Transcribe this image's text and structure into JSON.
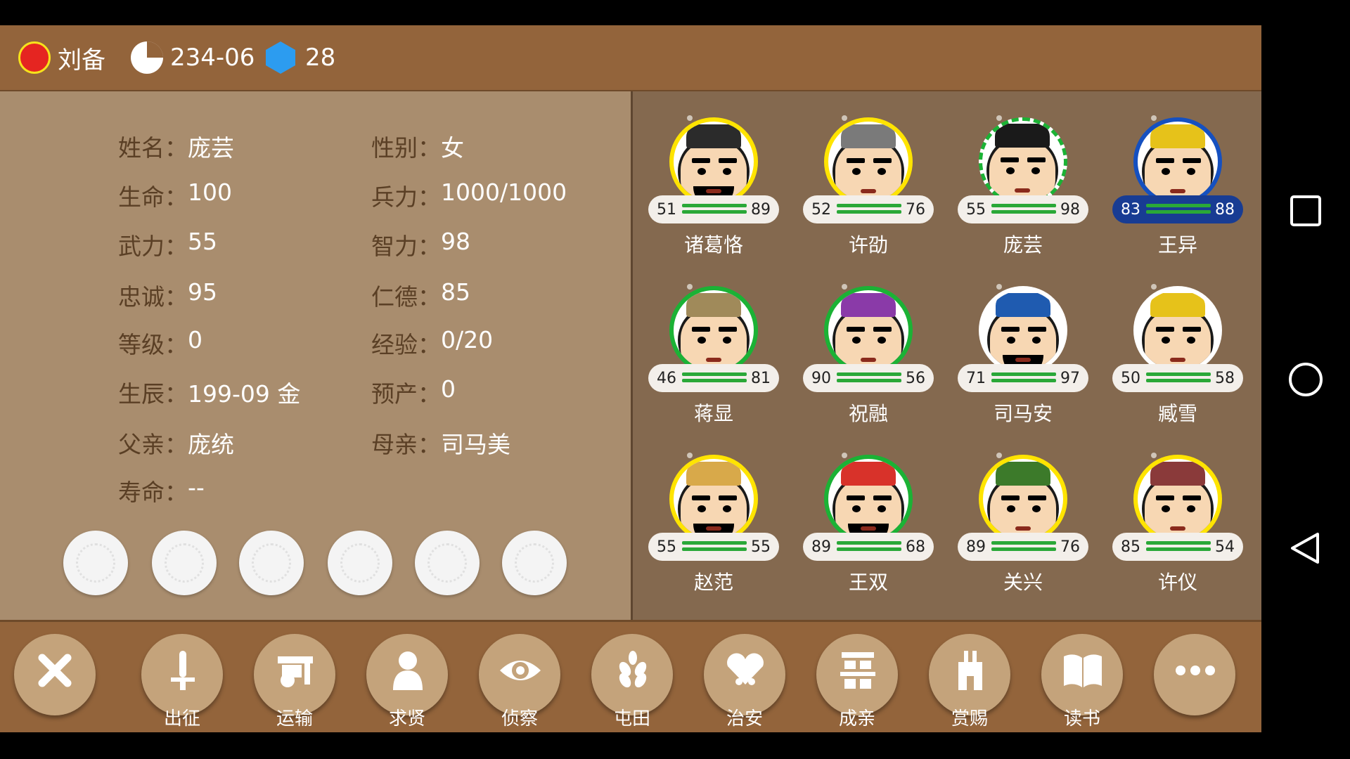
{
  "header": {
    "lord_name": "刘备",
    "date": "234-06",
    "gems": "28",
    "colors": {
      "faction": "#e52521",
      "faction_ring": "#f7e21b",
      "gem": "#2c9cf0"
    }
  },
  "info": {
    "rows": [
      {
        "k1": "姓名：",
        "v1": "庞芸",
        "k2": "性别：",
        "v2": "女"
      },
      {
        "k1": "生命：",
        "v1": "100",
        "k2": "兵力：",
        "v2": "1000/1000"
      },
      {
        "k1": "武力：",
        "v1": "55",
        "k2": "智力：",
        "v2": "98"
      },
      {
        "k1": "忠诚：",
        "v1": "95",
        "k2": "仁德：",
        "v2": "85"
      },
      {
        "k1": "等级：",
        "v1": "0",
        "k2": "经验：",
        "v2": "0/20"
      },
      {
        "k1": "生辰：",
        "v1": "199-09 金",
        "k2": "预产：",
        "v2": "0"
      },
      {
        "k1": "父亲：",
        "v1": "庞统",
        "k2": "母亲：",
        "v2": "司马美"
      },
      {
        "k1": "寿命：",
        "v1": "--",
        "k2": "",
        "v2": ""
      }
    ],
    "item_slots": 6
  },
  "generals": [
    {
      "name": "诸葛恪",
      "left": "51",
      "right": "89",
      "ring": "yellow",
      "hat": "#2b2b2b",
      "beard": true
    },
    {
      "name": "许劭",
      "left": "52",
      "right": "76",
      "ring": "yellow",
      "hat": "#7a7a7a",
      "beard": false
    },
    {
      "name": "庞芸",
      "left": "55",
      "right": "98",
      "ring": "green-dash",
      "hat": "#1a1a1a",
      "beard": false
    },
    {
      "name": "王异",
      "left": "83",
      "right": "88",
      "ring": "blue",
      "hat": "#e6c21a",
      "beard": false,
      "selected": true
    },
    {
      "name": "蒋显",
      "left": "46",
      "right": "81",
      "ring": "green",
      "hat": "#a08a5a",
      "beard": false
    },
    {
      "name": "祝融",
      "left": "90",
      "right": "56",
      "ring": "green",
      "hat": "#8a3aa8",
      "beard": false
    },
    {
      "name": "司马安",
      "left": "71",
      "right": "97",
      "ring": "white",
      "hat": "#1f5bb0",
      "beard": true
    },
    {
      "name": "臧雪",
      "left": "50",
      "right": "58",
      "ring": "white",
      "hat": "#e6c21a",
      "beard": false
    },
    {
      "name": "赵范",
      "left": "55",
      "right": "55",
      "ring": "yellow",
      "hat": "#d8a94a",
      "beard": true
    },
    {
      "name": "王双",
      "left": "89",
      "right": "68",
      "ring": "green",
      "hat": "#d8322a",
      "beard": true
    },
    {
      "name": "关兴",
      "left": "89",
      "right": "76",
      "ring": "yellow",
      "hat": "#3c7a2a",
      "beard": false
    },
    {
      "name": "许仪",
      "left": "85",
      "right": "54",
      "ring": "yellow",
      "hat": "#8a3a3a",
      "beard": false
    }
  ],
  "actions": [
    {
      "label": "",
      "icon": "close-icon"
    },
    {
      "label": "出征",
      "icon": "sword-icon"
    },
    {
      "label": "运输",
      "icon": "cart-icon"
    },
    {
      "label": "求贤",
      "icon": "person-icon"
    },
    {
      "label": "侦察",
      "icon": "eye-icon"
    },
    {
      "label": "屯田",
      "icon": "wheat-icon"
    },
    {
      "label": "治安",
      "icon": "hearts-icon"
    },
    {
      "label": "成亲",
      "icon": "double-happiness-icon"
    },
    {
      "label": "赏赐",
      "icon": "gift-icon"
    },
    {
      "label": "读书",
      "icon": "book-icon"
    },
    {
      "label": "",
      "icon": "more-icon"
    }
  ]
}
